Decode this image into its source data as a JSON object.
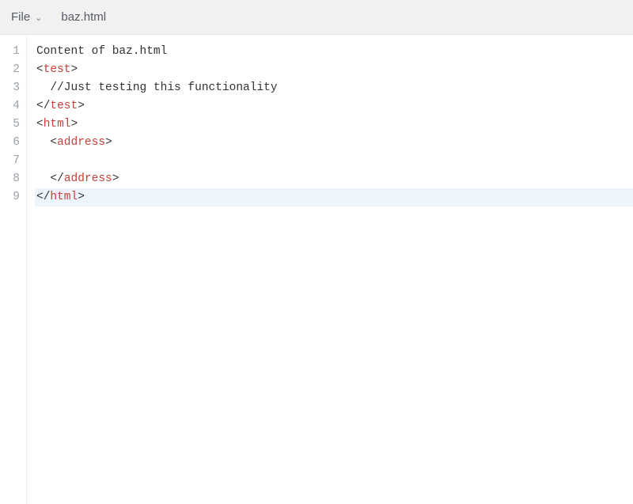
{
  "toolbar": {
    "file_menu_label": "File",
    "filename": "baz.html"
  },
  "editor": {
    "highlighted_line": 9,
    "lines": [
      {
        "n": 1,
        "indent": 0,
        "tokens": [
          {
            "t": "text",
            "v": "Content of baz.html"
          }
        ]
      },
      {
        "n": 2,
        "indent": 0,
        "tokens": [
          {
            "t": "punct",
            "v": "<"
          },
          {
            "t": "tag",
            "v": "test"
          },
          {
            "t": "punct",
            "v": ">"
          }
        ]
      },
      {
        "n": 3,
        "indent": 1,
        "tokens": [
          {
            "t": "text",
            "v": "//Just testing this functionality"
          }
        ]
      },
      {
        "n": 4,
        "indent": 0,
        "tokens": [
          {
            "t": "punct",
            "v": "</"
          },
          {
            "t": "tag",
            "v": "test"
          },
          {
            "t": "punct",
            "v": ">"
          }
        ]
      },
      {
        "n": 5,
        "indent": 0,
        "tokens": [
          {
            "t": "punct",
            "v": "<"
          },
          {
            "t": "tag",
            "v": "html"
          },
          {
            "t": "punct",
            "v": ">"
          }
        ]
      },
      {
        "n": 6,
        "indent": 1,
        "tokens": [
          {
            "t": "punct",
            "v": "<"
          },
          {
            "t": "tag",
            "v": "address"
          },
          {
            "t": "punct",
            "v": ">"
          }
        ]
      },
      {
        "n": 7,
        "indent": 0,
        "tokens": []
      },
      {
        "n": 8,
        "indent": 1,
        "tokens": [
          {
            "t": "punct",
            "v": "</"
          },
          {
            "t": "tag",
            "v": "address"
          },
          {
            "t": "punct",
            "v": ">"
          }
        ]
      },
      {
        "n": 9,
        "indent": 0,
        "tokens": [
          {
            "t": "punct",
            "v": "</"
          },
          {
            "t": "tag",
            "v": "html"
          },
          {
            "t": "punct",
            "v": ">"
          }
        ]
      }
    ]
  }
}
